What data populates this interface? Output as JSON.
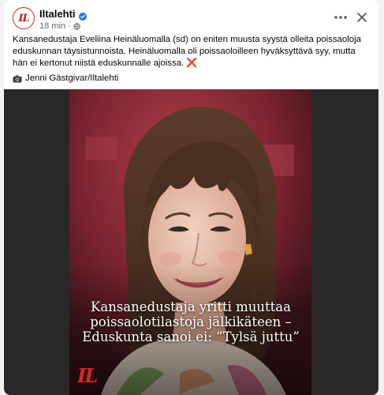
{
  "post": {
    "page_name": "Iltalehti",
    "avatar_text": "IL",
    "time": "18 min",
    "separator": "·",
    "paragraph_1": "Kansanedustaja Eveliina Heinäluomalla (sd) on eniten muusta syystä olleita poissaoloja eduskunnan täysistunnoista. Heinäluomalla oli poissaoloilleen hyväksyttävä syy, mutta hän ei kertonut niistä eduskunnalle ajoissa.",
    "paragraph_1_emoji": "❌",
    "credit": "Jenni Gästgivar/Iltalehti"
  },
  "media": {
    "headline": "Kansanedustaja yritti muuttaa poissaolotilastoja jälkikäteen – Eduskunta sanoi ei: ”Tylsä juttu”",
    "logo_text": "IL"
  },
  "colors": {
    "brand_red": "#d21b1b",
    "verified_blue": "#1877f2",
    "text_secondary": "#65676b"
  },
  "icons": {
    "verified": "verified-badge-icon",
    "audience": "globe-icon",
    "more": "more-options-icon",
    "close": "close-icon",
    "camera": "camera-icon"
  }
}
